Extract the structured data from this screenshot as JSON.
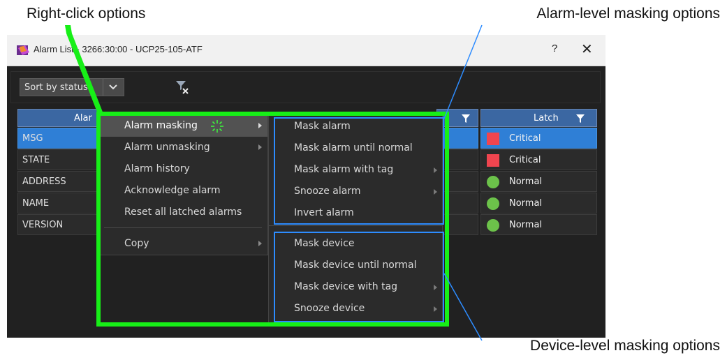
{
  "callouts": {
    "right_click": "Right-click options",
    "alarm_level": "Alarm-level masking options",
    "device_level": "Device-level masking options"
  },
  "window": {
    "title": "Alarm List - 3266:30:00 - UCP25-105-ATF",
    "help": "?",
    "close": "✕"
  },
  "toolbar": {
    "sort_value": "Sort by status"
  },
  "table": {
    "left_header": "Alar",
    "latch_header": "Latch",
    "rows": [
      {
        "name": "MSG",
        "latch": "Critical",
        "indicator": "red-square",
        "selected": true
      },
      {
        "name": "STATE",
        "latch": "Critical",
        "indicator": "red-square",
        "selected": false
      },
      {
        "name": "ADDRESS",
        "latch": "Normal",
        "indicator": "green-dot",
        "selected": false
      },
      {
        "name": "NAME",
        "latch": "Normal",
        "indicator": "green-dot",
        "selected": false
      },
      {
        "name": "VERSION",
        "latch": "Normal",
        "indicator": "green-dot",
        "selected": false
      }
    ]
  },
  "context_menu": {
    "items": [
      {
        "label": "Alarm masking",
        "has_submenu": true,
        "active": true
      },
      {
        "label": "Alarm unmasking",
        "has_submenu": true,
        "active": false
      },
      {
        "label": "Alarm history",
        "has_submenu": false,
        "active": false
      },
      {
        "label": "Acknowledge alarm",
        "has_submenu": false,
        "active": false
      },
      {
        "label": "Reset all latched alarms",
        "has_submenu": false,
        "active": false
      },
      {
        "label": "Copy",
        "has_submenu": true,
        "active": false
      }
    ]
  },
  "submenu": {
    "alarm_items": [
      {
        "label": "Mask alarm",
        "has_submenu": false
      },
      {
        "label": "Mask alarm until normal",
        "has_submenu": false
      },
      {
        "label": "Mask alarm with tag",
        "has_submenu": true
      },
      {
        "label": "Snooze alarm",
        "has_submenu": true
      },
      {
        "label": "Invert alarm",
        "has_submenu": false
      }
    ],
    "device_items": [
      {
        "label": "Mask device",
        "has_submenu": false
      },
      {
        "label": "Mask device until normal",
        "has_submenu": false
      },
      {
        "label": "Mask device with tag",
        "has_submenu": true
      },
      {
        "label": "Snooze device",
        "has_submenu": true
      }
    ]
  },
  "colors": {
    "highlight_green": "#17ef17",
    "highlight_blue": "#2d8cff",
    "critical_red": "#f0454f",
    "normal_green": "#6cc24a",
    "selection_blue": "#2f7fd6"
  }
}
